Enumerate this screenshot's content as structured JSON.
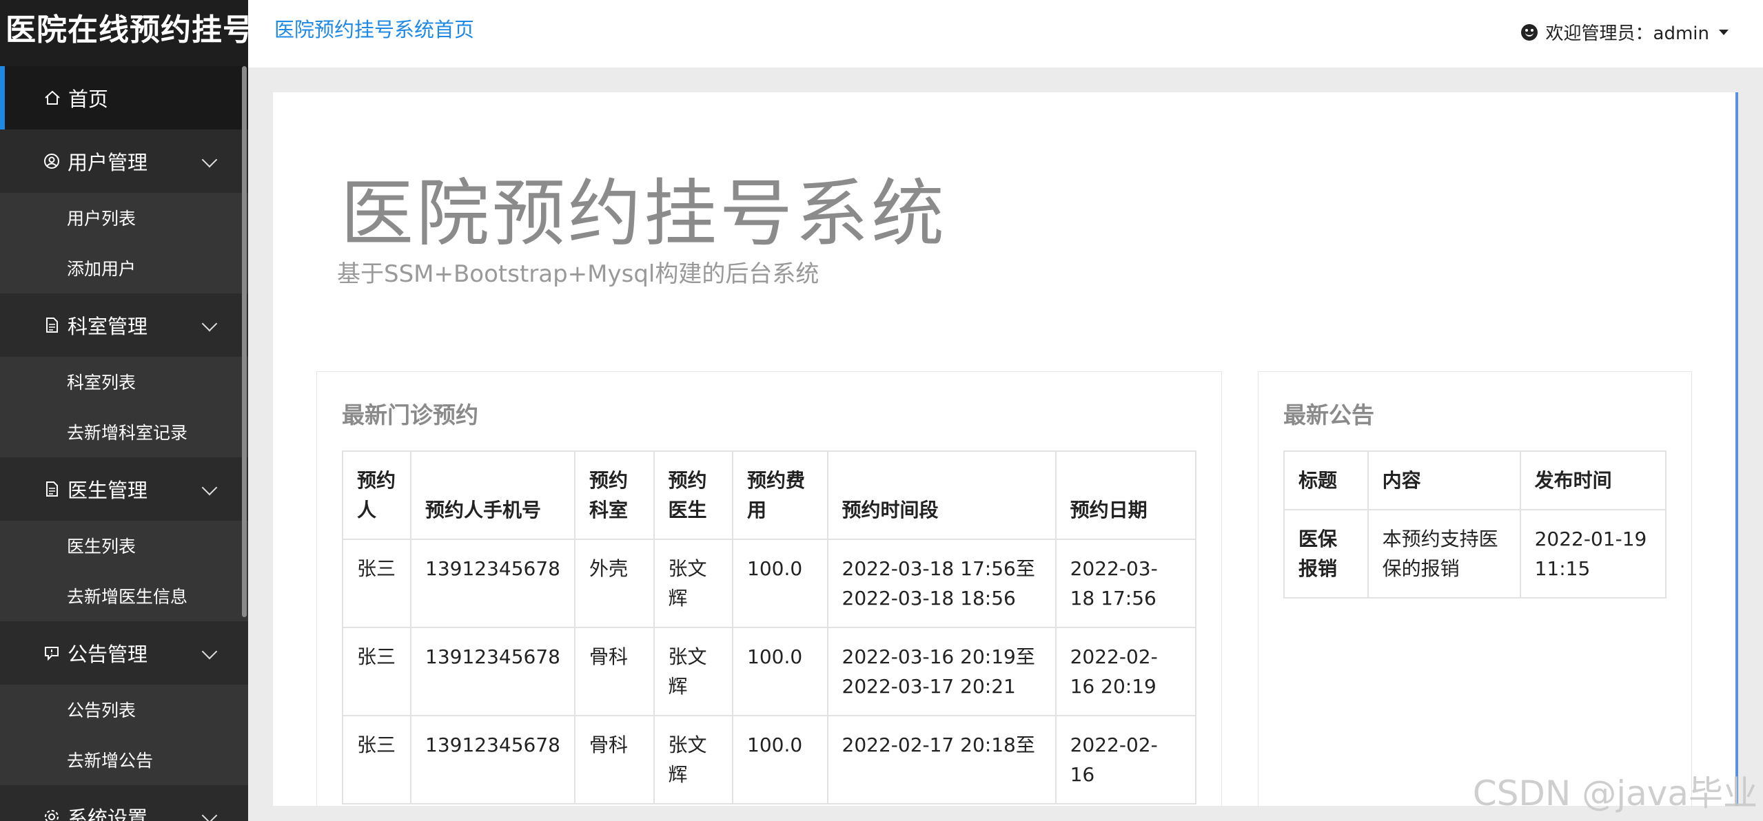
{
  "sidebar": {
    "brand": "医院在线预约挂号",
    "home": "首页",
    "groups": [
      {
        "label": "用户管理",
        "icon": "user-circle-icon",
        "items": [
          "用户列表",
          "添加用户"
        ]
      },
      {
        "label": "科室管理",
        "icon": "document-icon",
        "items": [
          "科室列表",
          "去新增科室记录"
        ]
      },
      {
        "label": "医生管理",
        "icon": "document-icon",
        "items": [
          "医生列表",
          "去新增医生信息"
        ]
      },
      {
        "label": "公告管理",
        "icon": "announcement-icon",
        "items": [
          "公告列表",
          "去新增公告"
        ]
      },
      {
        "label": "系统设置",
        "icon": "gear-icon",
        "items": []
      }
    ]
  },
  "header": {
    "home_link": "医院预约挂号系统首页",
    "user_label": "欢迎管理员：admin"
  },
  "hero": {
    "title": "医院预约挂号系统",
    "subtitle": "基于SSM+Bootstrap+Mysql构建的后台系统"
  },
  "appointments": {
    "title": "最新门诊预约",
    "columns": [
      "预约人",
      "预约人手机号",
      "预约科室",
      "预约医生",
      "预约费用",
      "预约时间段",
      "预约日期"
    ],
    "rows": [
      [
        "张三",
        "13912345678",
        "外壳",
        "张文辉",
        "100.0",
        "2022-03-18 17:56至2022-03-18 18:56",
        "2022-03-18 17:56"
      ],
      [
        "张三",
        "13912345678",
        "骨科",
        "张文辉",
        "100.0",
        "2022-03-16 20:19至2022-03-17 20:21",
        "2022-02-16 20:19"
      ],
      [
        "张三",
        "13912345678",
        "骨科",
        "张文辉",
        "100.0",
        "2022-02-17 20:18至",
        "2022-02-16"
      ]
    ]
  },
  "notices": {
    "title": "最新公告",
    "columns": [
      "标题",
      "内容",
      "发布时间"
    ],
    "rows": [
      [
        "医保报销",
        "本预约支持医保的报销",
        "2022-01-19 11:15"
      ]
    ]
  },
  "watermark": "CSDN @java毕业",
  "colors": {
    "accent": "#1e88e5",
    "sidebar": "#2d2d2d",
    "sidebar_active": "#191919"
  }
}
